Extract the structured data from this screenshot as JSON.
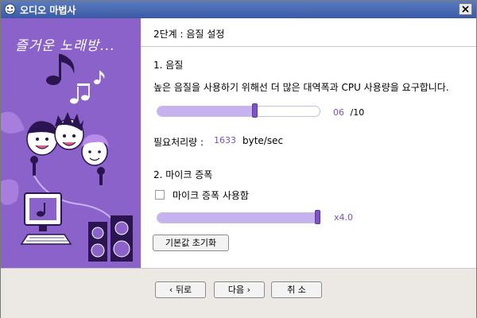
{
  "window": {
    "title": "오디오 마법사"
  },
  "banner": {
    "title": "즐거운 노래방..."
  },
  "header": {
    "step_title": "2단계 : 음질 설정"
  },
  "quality": {
    "section_label": "1. 음질",
    "description": "높은 음질을 사용하기 위해선 더 많은 대역폭과 CPU 사용량을 요구합니다.",
    "level_value": "06",
    "level_max": "/10",
    "level_fraction": 0.6,
    "required_label": "필요처리량 :",
    "required_value": "1633",
    "required_unit": "byte/sec"
  },
  "mic": {
    "section_label": "2. 마이크 증폭",
    "checkbox_label": "마이크 증폭 사용함",
    "checked": false,
    "boost_value": "x4.0",
    "boost_fraction": 1.0
  },
  "reset_button": "기본값 초기화",
  "footer": {
    "back_label": "뒤로",
    "next_label": "다음",
    "cancel_label": "취 소"
  },
  "colors": {
    "accent": "#7b4fc2",
    "slider_fill": "#c6b2ee",
    "banner": "#8a62c9"
  }
}
